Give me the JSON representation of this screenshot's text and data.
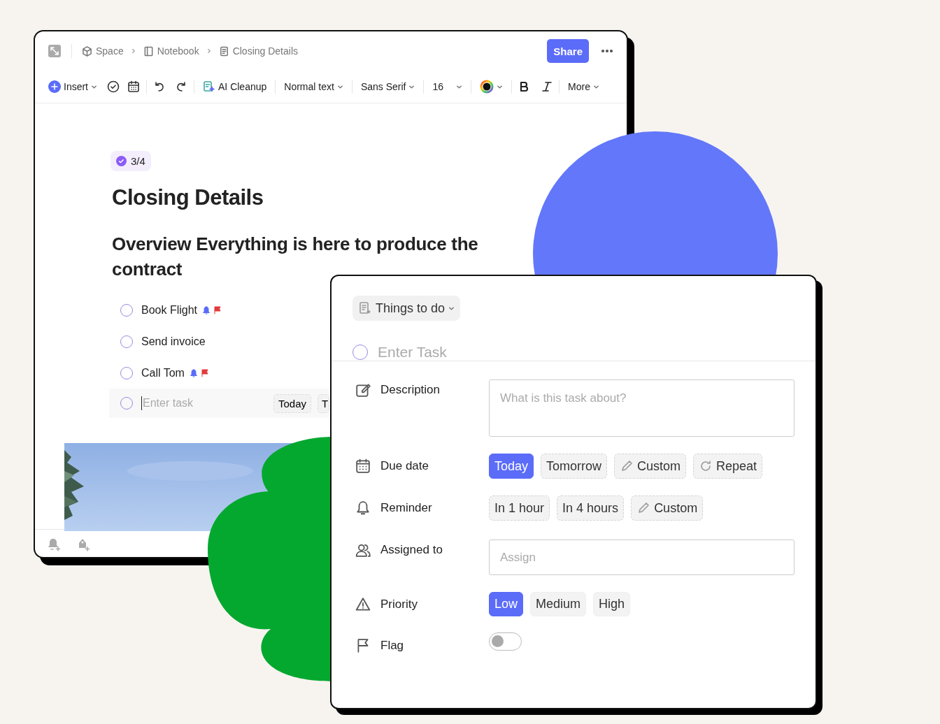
{
  "editor": {
    "breadcrumb": [
      "Space",
      "Notebook",
      "Closing Details"
    ],
    "share_button": "Share",
    "toolbar": {
      "insert": "Insert",
      "ai_cleanup": "AI Cleanup",
      "text_style": "Normal text",
      "font": "Sans Serif",
      "font_size": "16",
      "more": "More"
    },
    "document": {
      "progress": "3/4",
      "title": "Closing Details",
      "heading": "Overview Everything is here to produce the contract",
      "tasks": [
        {
          "name": "Book Flight",
          "checked": false,
          "reminder": true,
          "flag": true
        },
        {
          "name": "Send invoice",
          "checked": false,
          "reminder": false,
          "flag": false
        },
        {
          "name": "Call Tom",
          "checked": false,
          "reminder": true,
          "flag": true
        }
      ],
      "new_task": {
        "placeholder": "Enter task",
        "checked": false,
        "chips": [
          "Today",
          "T"
        ]
      }
    }
  },
  "task_panel": {
    "list": "Things to do",
    "task_placeholder": "Enter Task",
    "checked": false,
    "fields": [
      {
        "kind": "textarea",
        "label": "Description",
        "placeholder": "What is this task about?"
      },
      {
        "kind": "chips",
        "label": "Due date",
        "options": [
          {
            "label": "Today",
            "selected": true,
            "kind": "plain"
          },
          {
            "label": "Tomorrow",
            "selected": false,
            "kind": "plain"
          },
          {
            "label": "Custom",
            "selected": false,
            "kind": "custom"
          },
          {
            "label": "Repeat",
            "selected": false,
            "kind": "repeat"
          }
        ]
      },
      {
        "kind": "chips",
        "label": "Reminder",
        "options": [
          {
            "label": "In 1 hour",
            "selected": false,
            "kind": "plain"
          },
          {
            "label": "In 4 hours",
            "selected": false,
            "kind": "plain"
          },
          {
            "label": "Custom",
            "selected": false,
            "kind": "custom"
          }
        ]
      },
      {
        "kind": "input",
        "label": "Assigned to",
        "placeholder": "Assign"
      },
      {
        "kind": "choice",
        "label": "Priority",
        "options": [
          {
            "label": "Low",
            "selected": true,
            "kind": "plain"
          },
          {
            "label": "Medium",
            "selected": false,
            "kind": "plain"
          },
          {
            "label": "High",
            "selected": false,
            "kind": "plain"
          }
        ]
      },
      {
        "kind": "toggle",
        "label": "Flag",
        "on": false
      }
    ]
  }
}
